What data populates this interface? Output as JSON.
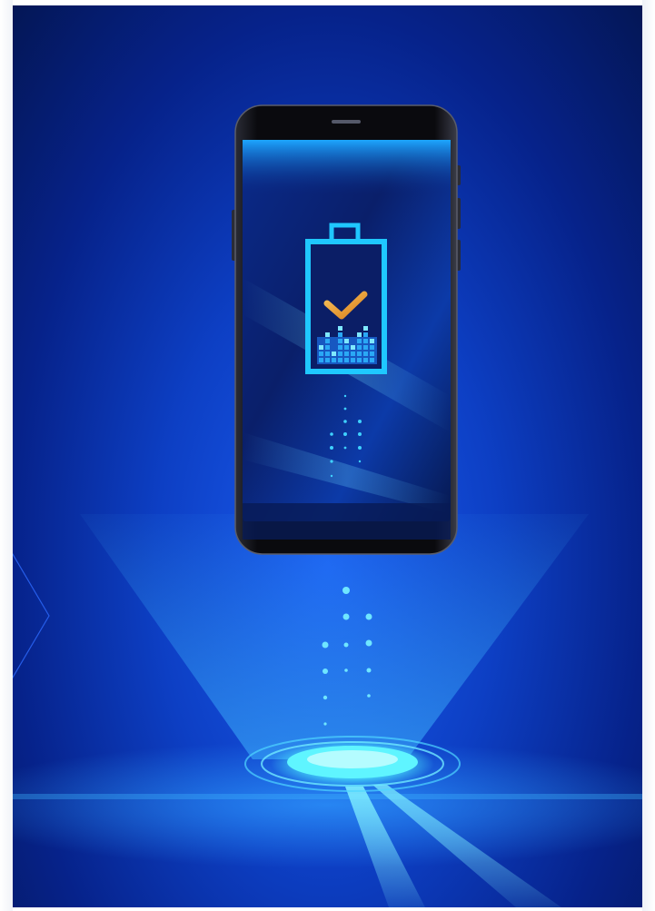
{
  "image": {
    "description_icons": [
      "phone-icon",
      "battery-icon",
      "checkmark-icon",
      "wireless-charging-pad-icon"
    ],
    "colors": {
      "background_dark": "#041654",
      "background_mid": "#0d3fc4",
      "background_glow": "#1a5cf0",
      "battery_cyan": "#1fc8ff",
      "checkmark_orange": "#f0a23a",
      "pad_glow": "#4ff3ff",
      "phone_bezel": "#0b0b10"
    },
    "battery_level": 0.45
  }
}
